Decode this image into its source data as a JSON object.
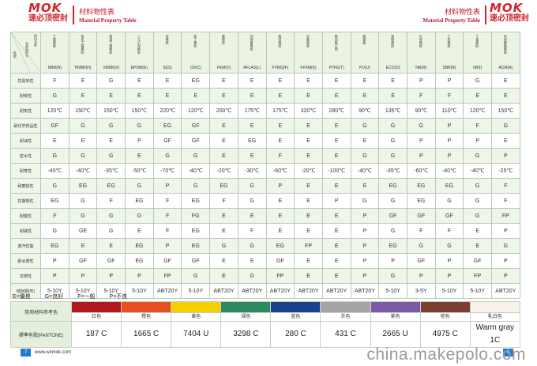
{
  "header": {
    "logo_text": "MOK",
    "logo_subtitle": "速必顶密封",
    "title_cn": "材料物性表",
    "title_en": "Material Property Table"
  },
  "corner": {
    "top": "材料名称",
    "mid": "名称和符号",
    "low": "性能"
  },
  "columns": [
    {
      "name": "丁腈橡胶",
      "code": "NBR(N)"
    },
    {
      "name": "氢化丁腈橡胶",
      "code": "HNBR(H)"
    },
    {
      "name": "羧基丁腈橡胶",
      "code": "XNBR(X)"
    },
    {
      "name": "三元乙丙橡胶",
      "code": "EPDM(E)"
    },
    {
      "name": "硅橡胶",
      "code": "SI(S)"
    },
    {
      "name": "氯丁橡胶",
      "code": "CR(C)"
    },
    {
      "name": "氟橡胶",
      "code": "FKM(V)"
    },
    {
      "name": "四丙氟橡胶",
      "code": "AFLAS(L)"
    },
    {
      "name": "氟硅橡胶",
      "code": "FVMQ(F)"
    },
    {
      "name": "全氟橡胶",
      "code": "FFKM(K)"
    },
    {
      "name": "聚四氟乙烯",
      "code": "PTFE(T)"
    },
    {
      "name": "聚氨酯",
      "code": "PU(U)"
    },
    {
      "name": "氯醚橡胶",
      "code": "ECO(D)"
    },
    {
      "name": "天然橡胶",
      "code": "NR(R)"
    },
    {
      "name": "丁苯橡胶",
      "code": "SBR(B)"
    },
    {
      "name": "丁基橡胶",
      "code": "IIR(I)"
    },
    {
      "name": "丙烯酸酯橡胶",
      "code": "ACM(A)"
    }
  ],
  "rows": [
    {
      "label": "抗臭氧性",
      "values": [
        "F",
        "E",
        "G",
        "E",
        "E",
        "EG",
        "E",
        "E",
        "E",
        "E",
        "E",
        "E",
        "E",
        "P",
        "P",
        "G",
        "E"
      ]
    },
    {
      "label": "耐候性",
      "values": [
        "G",
        "E",
        "E",
        "E",
        "E",
        "E",
        "E",
        "E",
        "E",
        "E",
        "E",
        "E",
        "E",
        "F",
        "F",
        "E",
        "E"
      ]
    },
    {
      "label": "耐热性",
      "values": [
        "120℃",
        "150℃",
        "150℃",
        "150℃",
        "220℃",
        "120℃",
        "200℃",
        "175℃",
        "175℃",
        "320℃",
        "280℃",
        "90℃",
        "135℃",
        "90℃",
        "110℃",
        "120℃",
        "150℃"
      ]
    },
    {
      "label": "耐化学药品性",
      "values": [
        "GF",
        "G",
        "G",
        "G",
        "EG",
        "GF",
        "E",
        "E",
        "E",
        "E",
        "E",
        "G",
        "G",
        "G",
        "P",
        "F",
        "G"
      ]
    },
    {
      "label": "耐油性",
      "values": [
        "E",
        "E",
        "E",
        "P",
        "GF",
        "GF",
        "E",
        "EG",
        "E",
        "E",
        "E",
        "E",
        "G",
        "P",
        "P",
        "P",
        "E"
      ]
    },
    {
      "label": "密水性",
      "values": [
        "G",
        "G",
        "G",
        "E",
        "G",
        "G",
        "E",
        "E",
        "F",
        "E",
        "E",
        "G",
        "G",
        "P",
        "P",
        "G",
        "P"
      ]
    },
    {
      "label": "耐寒性",
      "values": [
        "-40℃",
        "-40℃",
        "-35℃",
        "-50℃",
        "-70℃",
        "-40℃",
        "-20℃",
        "-30℃",
        "-60℃",
        "-20℃",
        "-100℃",
        "-40℃",
        "-35℃",
        "-60℃",
        "-40℃",
        "-40℃",
        "-25℃"
      ]
    },
    {
      "label": "耐磨损性",
      "values": [
        "G",
        "EG",
        "EG",
        "G",
        "P",
        "G",
        "EG",
        "G",
        "P",
        "E",
        "E",
        "E",
        "EG",
        "EG",
        "EG",
        "G",
        "F"
      ]
    },
    {
      "label": "抗撕裂性",
      "values": [
        "EG",
        "G",
        "F",
        "EG",
        "F",
        "EG",
        "F",
        "G",
        "E",
        "E",
        "P",
        "G",
        "G",
        "EG",
        "G",
        "G",
        "F"
      ]
    },
    {
      "label": "耐酸性",
      "values": [
        "F",
        "G",
        "G",
        "G",
        "F",
        "FG",
        "E",
        "E",
        "E",
        "E",
        "E",
        "P",
        "GF",
        "GF",
        "GF",
        "G",
        "FP"
      ]
    },
    {
      "label": "耐碱性",
      "values": [
        "G",
        "GE",
        "G",
        "E",
        "F",
        "EG",
        "E",
        "F",
        "E",
        "E",
        "E",
        "P",
        "G",
        "F",
        "F",
        "E",
        "P"
      ]
    },
    {
      "label": "蒸汽性能",
      "values": [
        "EG",
        "E",
        "E",
        "EG",
        "P",
        "EG",
        "G",
        "G",
        "EG",
        "FP",
        "E",
        "P",
        "EG",
        "G",
        "G",
        "E",
        "G"
      ]
    },
    {
      "label": "耐水蒸性",
      "values": [
        "P",
        "GF",
        "GF",
        "EG",
        "GF",
        "GF",
        "E",
        "E",
        "GF",
        "E",
        "E",
        "P",
        "P",
        "GF",
        "P",
        "GF",
        "P"
      ]
    },
    {
      "label": "抗燃性",
      "values": [
        "P",
        "P",
        "P",
        "P",
        "FP",
        "G",
        "E",
        "G",
        "FP",
        "E",
        "E",
        "P",
        "G",
        "P",
        "P",
        "FP",
        "P"
      ]
    },
    {
      "label": "储存期(年)",
      "values": [
        "5-10Y",
        "5-10Y",
        "5-10Y",
        "5-10Y",
        "ABT20Y",
        "5-10Y",
        "ABT20Y",
        "ABT20Y",
        "ABT20Y",
        "ABT20Y",
        "ABT20Y",
        "ABT20Y",
        "5-10Y",
        "3-5Y",
        "5-10Y",
        "5-10Y",
        "ABT20Y"
      ]
    }
  ],
  "legend": {
    "e": "E=優良",
    "g": "G=良好",
    "f": "F=一般",
    "p": "P=不良"
  },
  "colors": {
    "row1_label": "常用材料参考色",
    "row2_label": "標準色號(PANTONE)",
    "items": [
      {
        "name": "红色",
        "code": "187 C",
        "hex": "#b0181e"
      },
      {
        "name": "橙色",
        "code": "1665 C",
        "hex": "#e4511e"
      },
      {
        "name": "黄色",
        "code": "7404 U",
        "hex": "#f5d000"
      },
      {
        "name": "绿色",
        "code": "3298 C",
        "hex": "#2b8a5e"
      },
      {
        "name": "蓝色",
        "code": "280 C",
        "hex": "#1c3f8f"
      },
      {
        "name": "灰色",
        "code": "431 C",
        "hex": "#a3a5a8"
      },
      {
        "name": "紫色",
        "code": "2665 U",
        "hex": "#7a5aa6"
      },
      {
        "name": "棕色",
        "code": "4975 C",
        "hex": "#7c4032"
      },
      {
        "name": "乳白色",
        "code": "Warm gray 1C",
        "hex": "#f7f3ea"
      }
    ]
  },
  "footer": {
    "page_left": "7",
    "page_right": "8",
    "url": "www.wxmok.com",
    "watermark": "china.makepolo.com"
  },
  "accent_color": "#d2232a"
}
